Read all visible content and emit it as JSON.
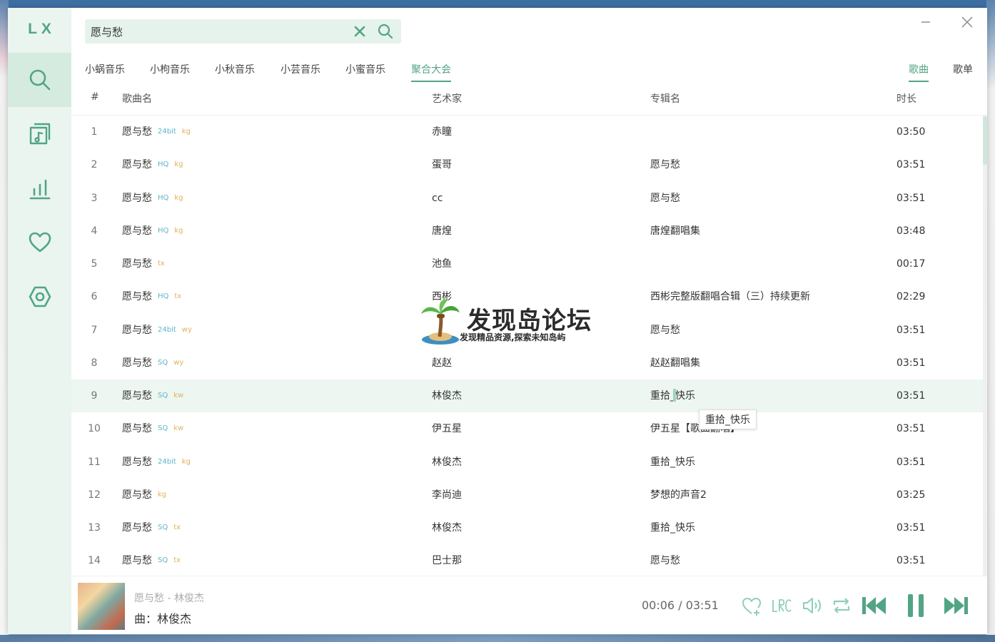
{
  "app": {
    "logo": "LX"
  },
  "colors": {
    "accent": "#52a584",
    "sidebar_bg": "#eaf5ef",
    "quality_badge": "#5fb3c9",
    "source_badge": "#e0b158"
  },
  "sidebar": {
    "items": [
      {
        "icon": "search-icon",
        "active": true
      },
      {
        "icon": "music-list-icon",
        "active": false
      },
      {
        "icon": "chart-icon",
        "active": false
      },
      {
        "icon": "heart-icon",
        "active": false
      },
      {
        "icon": "settings-icon",
        "active": false
      }
    ]
  },
  "search": {
    "value": "愿与愁",
    "placeholder": ""
  },
  "source_tabs": [
    "小蜗音乐",
    "小枸音乐",
    "小秋音乐",
    "小芸音乐",
    "小蜜音乐",
    "聚合大会"
  ],
  "active_source": "聚合大会",
  "type_tabs": [
    "歌曲",
    "歌单"
  ],
  "active_type": "歌曲",
  "table": {
    "headers": {
      "num": "#",
      "name": "歌曲名",
      "artist": "艺术家",
      "album": "专辑名",
      "duration": "时长"
    },
    "rows": [
      {
        "num": "1",
        "name": "愿与愁",
        "quality": "24bit",
        "source": "kg",
        "artist": "赤瞳",
        "album": "",
        "duration": "03:50"
      },
      {
        "num": "2",
        "name": "愿与愁",
        "quality": "HQ",
        "source": "kg",
        "artist": "蛋哥",
        "album": "愿与愁",
        "duration": "03:51"
      },
      {
        "num": "3",
        "name": "愿与愁",
        "quality": "HQ",
        "source": "kg",
        "artist": "cc",
        "album": "愿与愁",
        "duration": "03:51"
      },
      {
        "num": "4",
        "name": "愿与愁",
        "quality": "HQ",
        "source": "kg",
        "artist": "唐煌",
        "album": "唐煌翻唱集",
        "duration": "03:48"
      },
      {
        "num": "5",
        "name": "愿与愁",
        "quality": "",
        "source": "tx",
        "artist": "池鱼",
        "album": "",
        "duration": "00:17"
      },
      {
        "num": "6",
        "name": "愿与愁",
        "quality": "HQ",
        "source": "tx",
        "artist": "西彬",
        "album": "西彬完整版翻唱合辑（三）持续更新",
        "duration": "02:29"
      },
      {
        "num": "7",
        "name": "愿与愁",
        "quality": "24bit",
        "source": "wy",
        "artist": "",
        "album": "愿与愁",
        "duration": "03:51"
      },
      {
        "num": "8",
        "name": "愿与愁",
        "quality": "SQ",
        "source": "wy",
        "artist": "赵赵",
        "album": "赵赵翻唱集",
        "duration": "03:51"
      },
      {
        "num": "9",
        "name": "愿与愁",
        "quality": "SQ",
        "source": "kw",
        "artist": "林俊杰",
        "album": "重拾_快乐",
        "duration": "03:51"
      },
      {
        "num": "10",
        "name": "愿与愁",
        "quality": "SQ",
        "source": "kw",
        "artist": "伊五星",
        "album": "伊五星【歌曲翻唱】",
        "duration": "03:51"
      },
      {
        "num": "11",
        "name": "愿与愁",
        "quality": "24bit",
        "source": "kg",
        "artist": "林俊杰",
        "album": "重拾_快乐",
        "duration": "03:51"
      },
      {
        "num": "12",
        "name": "愿与愁",
        "quality": "",
        "source": "kg",
        "artist": "李尚迪",
        "album": "梦想的声音2",
        "duration": "03:25"
      },
      {
        "num": "13",
        "name": "愿与愁",
        "quality": "SQ",
        "source": "tx",
        "artist": "林俊杰",
        "album": "重拾_快乐",
        "duration": "03:51"
      },
      {
        "num": "14",
        "name": "愿与愁",
        "quality": "SQ",
        "source": "tx",
        "artist": "巴士那",
        "album": "愿与愁",
        "duration": "03:51"
      }
    ],
    "hovered_row": 9
  },
  "tooltip": "重拾_快乐",
  "watermark": {
    "title": "发现岛论坛",
    "subtitle": "发现精品资源,探索未知岛屿"
  },
  "player": {
    "title": "愿与愁 - 林俊杰",
    "lyric": "曲：林俊杰",
    "current_time": "00:06",
    "total_time": "03:51",
    "time_separator": "/",
    "controls": [
      "heart-plus-icon",
      "lrc-icon",
      "volume-icon",
      "repeat-icon",
      "prev-icon",
      "pause-icon",
      "next-icon"
    ]
  }
}
